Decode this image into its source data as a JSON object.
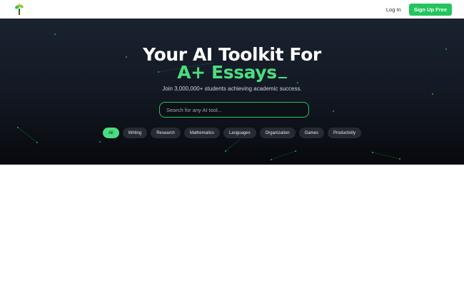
{
  "header": {
    "logo_icon": "plant-sprout-icon",
    "login_label": "Log In",
    "signup_label": "Sign Up Free",
    "accent_color": "#22c55e"
  },
  "hero": {
    "headline_line1": "Your AI Toolkit For",
    "headline_line2": "A+ Essays",
    "subtitle": "Join 3,000,000+ students achieving academic success.",
    "search_placeholder": "Search for any AI tool...",
    "background_color": "#141a25",
    "highlight_color": "#4ade80"
  },
  "categories": {
    "selected": "All",
    "items": [
      "All",
      "Writing",
      "Research",
      "Mathematics",
      "Languages",
      "Organization",
      "Games",
      "Productivity"
    ]
  }
}
